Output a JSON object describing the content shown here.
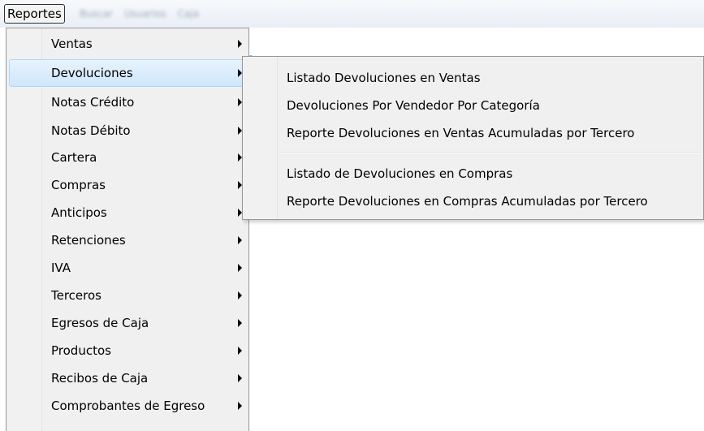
{
  "menubar": {
    "active_menu": "Reportes",
    "blurred_items": [
      "Buscar",
      "Usuarios",
      "Caja"
    ]
  },
  "menu": {
    "items": [
      {
        "label": "Ventas",
        "has_submenu": true
      },
      {
        "label": "Devoluciones",
        "has_submenu": true,
        "selected": true
      },
      {
        "label": "Notas Crédito",
        "has_submenu": true
      },
      {
        "label": "Notas Débito",
        "has_submenu": true
      },
      {
        "label": "Cartera",
        "has_submenu": true
      },
      {
        "label": "Compras",
        "has_submenu": true
      },
      {
        "label": "Anticipos",
        "has_submenu": true
      },
      {
        "label": "Retenciones",
        "has_submenu": true
      },
      {
        "label": "IVA",
        "has_submenu": true
      },
      {
        "label": "Terceros",
        "has_submenu": true
      },
      {
        "label": "Egresos de Caja",
        "has_submenu": true
      },
      {
        "label": "Productos",
        "has_submenu": true
      },
      {
        "label": "Recibos de Caja",
        "has_submenu": true
      },
      {
        "label": "Comprobantes de Egreso",
        "has_submenu": true
      }
    ]
  },
  "submenu": {
    "group_1": [
      "Listado Devoluciones en Ventas",
      "Devoluciones Por Vendedor Por Categoría",
      "Reporte Devoluciones en Ventas Acumuladas por Tercero"
    ],
    "group_2": [
      "Listado de Devoluciones en Compras",
      "Reporte Devoluciones en Compras Acumuladas por Tercero"
    ]
  },
  "colors": {
    "menu_bg": "#f0f0f0",
    "selection_border": "#a8d8f8",
    "selection_fill": "#cfe7fb",
    "menu_border": "#979797"
  }
}
